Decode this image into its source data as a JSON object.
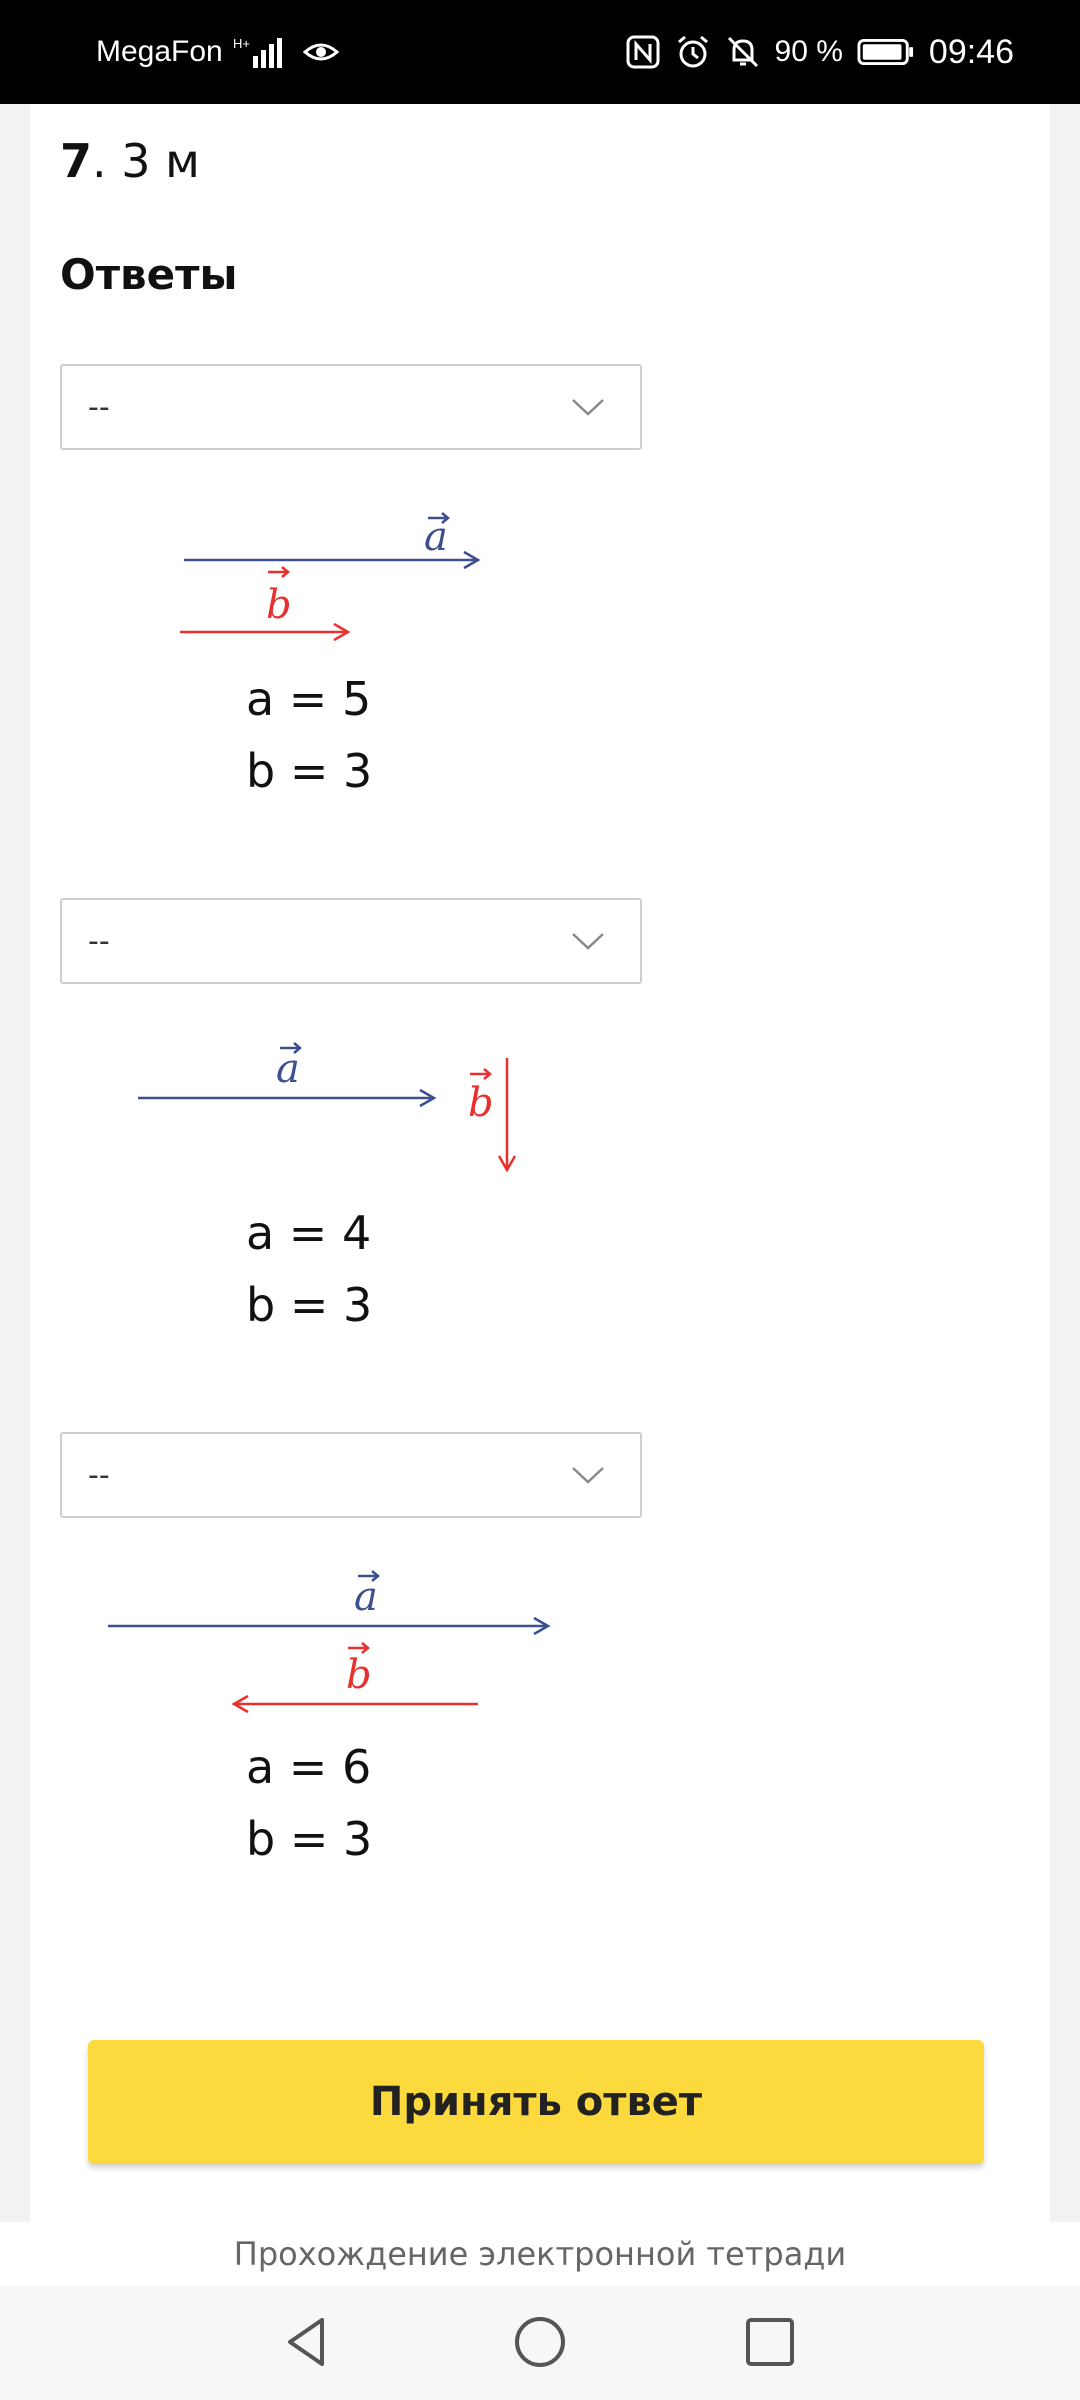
{
  "status_bar": {
    "carrier": "MegaFon",
    "battery": "90 %",
    "time": "09:46",
    "icons": [
      "signal-icon",
      "eye-icon",
      "nfc-icon",
      "alarm-icon",
      "bell-off-icon",
      "battery-icon"
    ]
  },
  "question": {
    "number": "7",
    "text": ". 3 м"
  },
  "answers_heading": "Ответы",
  "answers": [
    {
      "dropdown_value": "--",
      "a_label": "a",
      "b_label": "b",
      "a_text": "a = 5",
      "b_text": "b = 3",
      "arrangement": "same-direction"
    },
    {
      "dropdown_value": "--",
      "a_label": "a",
      "b_label": "b",
      "a_text": "a = 4",
      "b_text": "b = 3",
      "arrangement": "perpendicular"
    },
    {
      "dropdown_value": "--",
      "a_label": "a",
      "b_label": "b",
      "a_text": "a = 6",
      "b_text": "b = 3",
      "arrangement": "opposite-direction"
    }
  ],
  "submit_label": "Принять ответ",
  "footer_caption": "Прохождение электронной тетради",
  "colors": {
    "accent_yellow": "#fcd93c",
    "vector_a": "#3c4f8f",
    "vector_b": "#e8302f"
  },
  "nav_bar": [
    "back-icon",
    "home-icon",
    "recents-icon"
  ]
}
